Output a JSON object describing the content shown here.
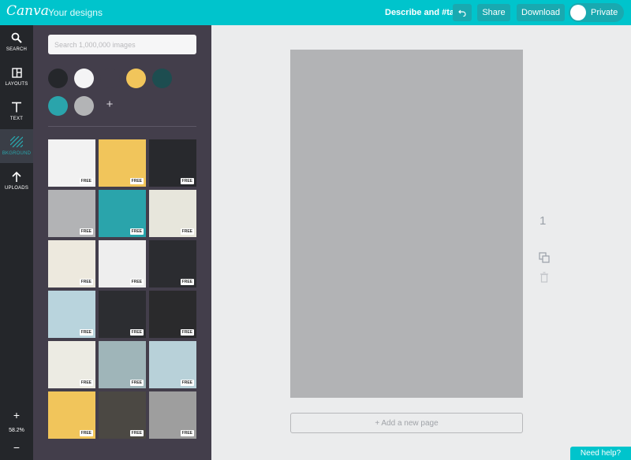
{
  "topbar": {
    "logo": "Canva",
    "your_designs": "Your designs",
    "describe": "Describe and #tag",
    "share_label": "Share",
    "download_label": "Download",
    "private_label": "Private"
  },
  "leftnav": {
    "items": [
      {
        "label": "SEARCH",
        "icon": "search-icon"
      },
      {
        "label": "LAYOUTS",
        "icon": "layouts-icon"
      },
      {
        "label": "TEXT",
        "icon": "text-icon"
      },
      {
        "label": "BKGROUND",
        "icon": "background-icon"
      },
      {
        "label": "UPLOADS",
        "icon": "upload-icon"
      }
    ],
    "zoom_plus": "+",
    "zoom_level": "58.2%",
    "zoom_minus": "−"
  },
  "panel": {
    "search_placeholder": "Search 1,000,000 images",
    "swatches": [
      "#25272b",
      "#f4f4f5",
      "#433e4b",
      "#f1c55b",
      "#1d4d50",
      "#2aa4ab",
      "#b3b4b6"
    ],
    "add_color": "+",
    "free_badge": "FREE",
    "tiles": [
      "#f2f2f2",
      "#f1c55b",
      "#28292d",
      "#b2b3b5",
      "#2aa4ab",
      "#e7e6dc",
      "#ede9de",
      "#eeeeee",
      "#2b2c30",
      "#b9d4dd",
      "#2c2d31",
      "#2a2a2c",
      "#ecebe3",
      "#9fb5b9",
      "#b8d1d9",
      "#f1c55b",
      "#4b4843",
      "#9e9e9e"
    ]
  },
  "canvas": {
    "page_number": "1",
    "add_page": "+ Add a new page"
  },
  "help": {
    "label": "Need help?"
  }
}
